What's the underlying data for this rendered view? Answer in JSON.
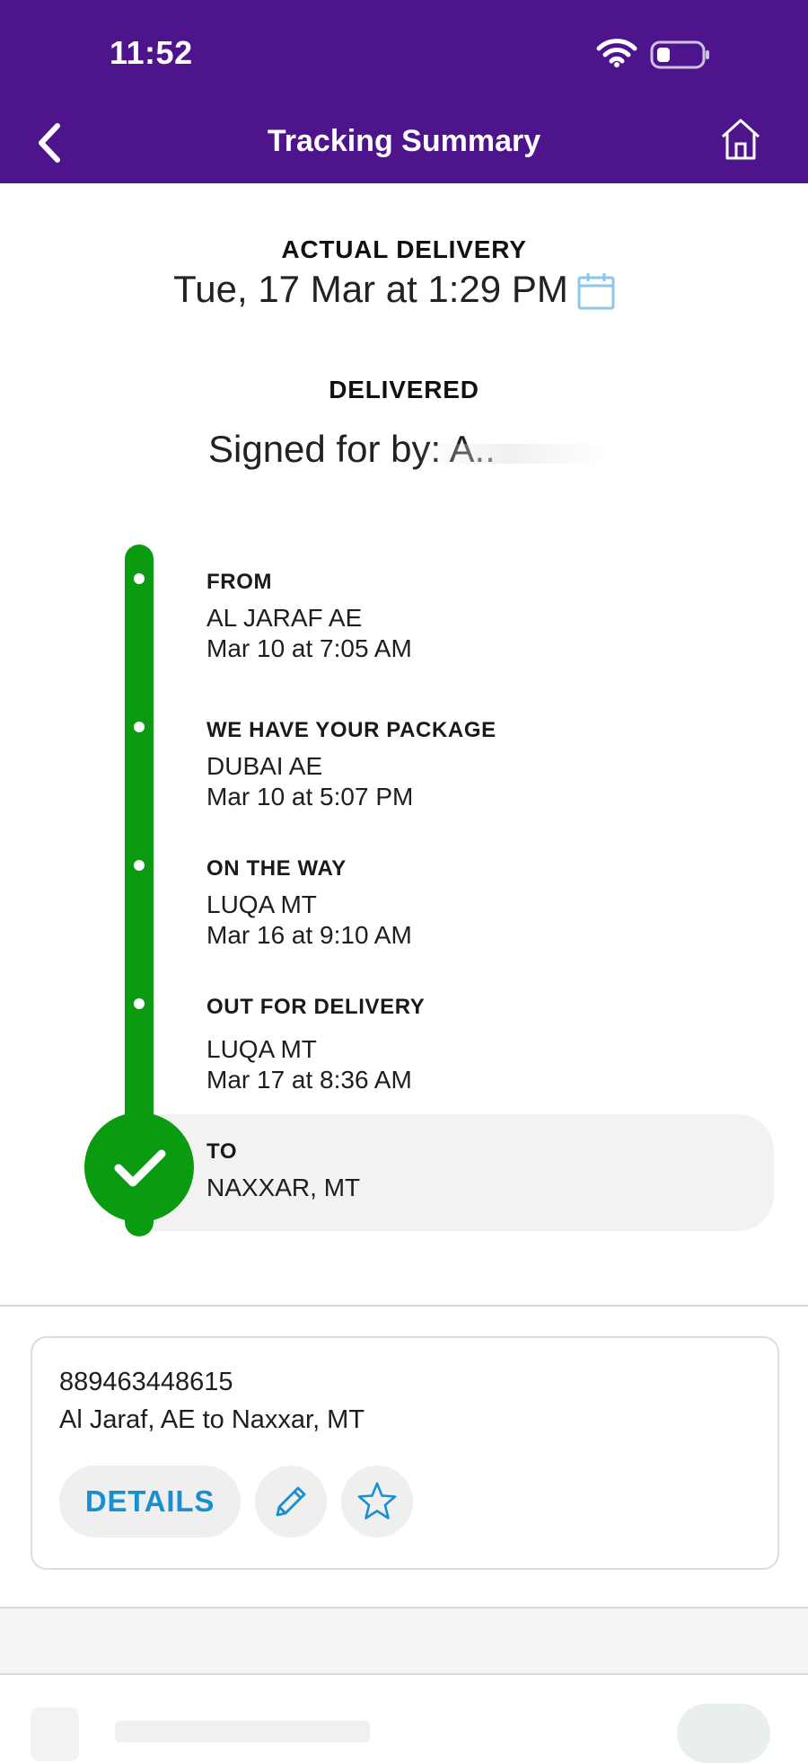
{
  "status_bar": {
    "time": "11:52"
  },
  "header": {
    "title": "Tracking Summary"
  },
  "summary": {
    "actual_delivery_label": "ACTUAL DELIVERY",
    "delivery_datetime": "Tue, 17 Mar at 1:29 PM",
    "status": "DELIVERED",
    "signed_for": "Signed for by: A.."
  },
  "timeline": [
    {
      "title": "FROM",
      "location": "AL JARAF AE",
      "time": "Mar 10 at 7:05 AM"
    },
    {
      "title": "WE HAVE YOUR PACKAGE",
      "location": "DUBAI AE",
      "time": "Mar 10 at 5:07 PM"
    },
    {
      "title": "ON THE WAY",
      "location": "LUQA MT",
      "time": "Mar 16 at 9:10 AM"
    },
    {
      "title": "OUT FOR DELIVERY",
      "location": "LUQA MT",
      "time": "Mar 17 at 8:36 AM"
    },
    {
      "title": "TO",
      "location": "NAXXAR, MT"
    }
  ],
  "shipment_card": {
    "tracking_number": "889463448615",
    "route": "Al Jaraf, AE to Naxxar, MT",
    "details_label": "DETAILS"
  },
  "colors": {
    "header_bg": "#4d148c",
    "timeline_green": "#0a9b10",
    "link_blue": "#1a8fd0"
  },
  "icons": [
    "back-chevron-icon",
    "home-icon",
    "calendar-icon",
    "wifi-icon",
    "battery-icon",
    "check-icon",
    "pencil-icon",
    "star-icon"
  ]
}
